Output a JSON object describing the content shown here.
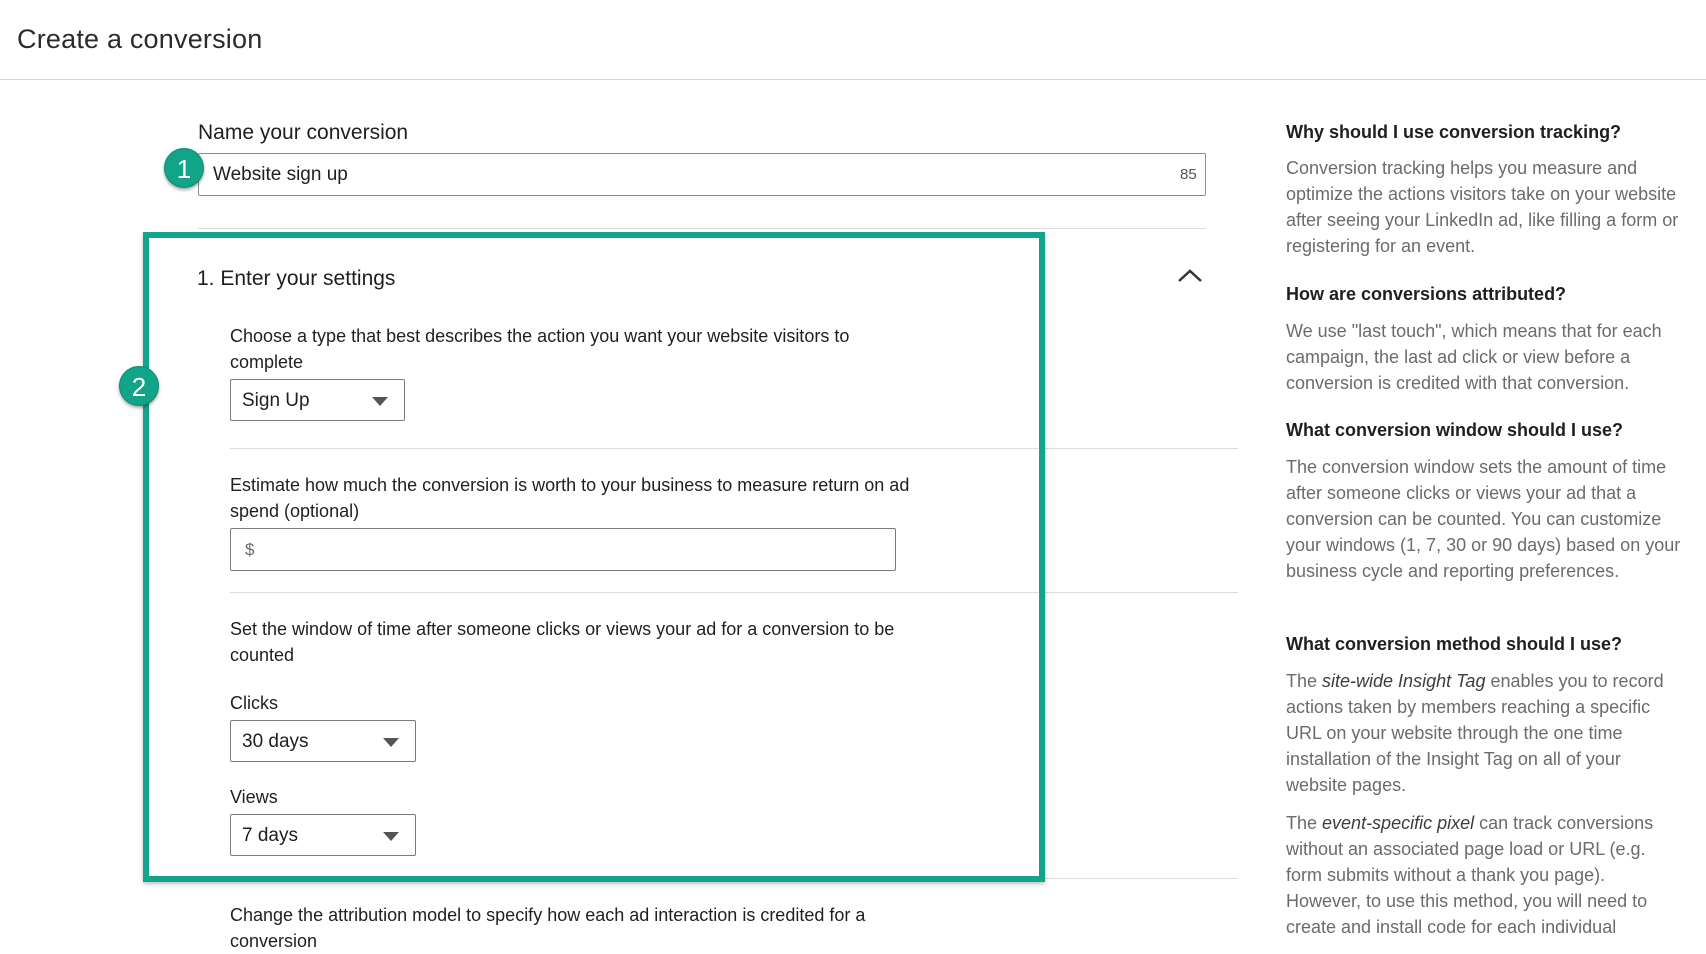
{
  "header": {
    "title": "Create a conversion"
  },
  "name_section": {
    "label": "Name your conversion",
    "value": "Website sign up",
    "char_count": "85"
  },
  "badges": {
    "one": "1",
    "two": "2"
  },
  "settings": {
    "heading": "1. Enter your settings",
    "type_question": "Choose a type that best describes the action you want your website visitors to complete",
    "type_value": "Sign Up",
    "value_question": "Estimate how much the conversion is worth to your business to measure return on ad spend (optional)",
    "value_placeholder": "$",
    "window_question": "Set the window of time after someone clicks or views your ad for a conversion to be counted",
    "clicks_label": "Clicks",
    "clicks_value": "30 days",
    "views_label": "Views",
    "views_value": "7 days",
    "attribution_question": "Change the attribution model to specify how each ad interaction is credited for a conversion"
  },
  "sidebar": {
    "q1": "Why should I use conversion tracking?",
    "a1": "Conversion tracking helps you measure and optimize the actions visitors take on your website after seeing your LinkedIn ad, like filling a form or registering for an event.",
    "q2": "How are conversions attributed?",
    "a2": "We use \"last touch\", which means that for each campaign, the last ad click or view before a conversion is credited with that conversion.",
    "q3": "What conversion window should I use?",
    "a3": "The conversion window sets the amount of time after someone clicks or views your ad that a conversion can be counted. You can customize your windows (1, 7, 30 or 90 days) based on your business cycle and reporting preferences.",
    "q4": "What conversion method should I use?",
    "a4_pre": "The ",
    "a4_em": "site-wide Insight Tag",
    "a4_post": " enables you to record actions taken by members reaching a specific URL on your website through the one time installation of the Insight Tag on all of your website pages.",
    "a5_pre": "The ",
    "a5_em": "event-specific pixel",
    "a5_post": " can track conversions without an associated page load or URL (e.g. form submits without a thank you page). However, to use this method, you will need to create and install code for each individual"
  },
  "colors": {
    "highlight": "#13a58b",
    "badge": "#12a489"
  }
}
